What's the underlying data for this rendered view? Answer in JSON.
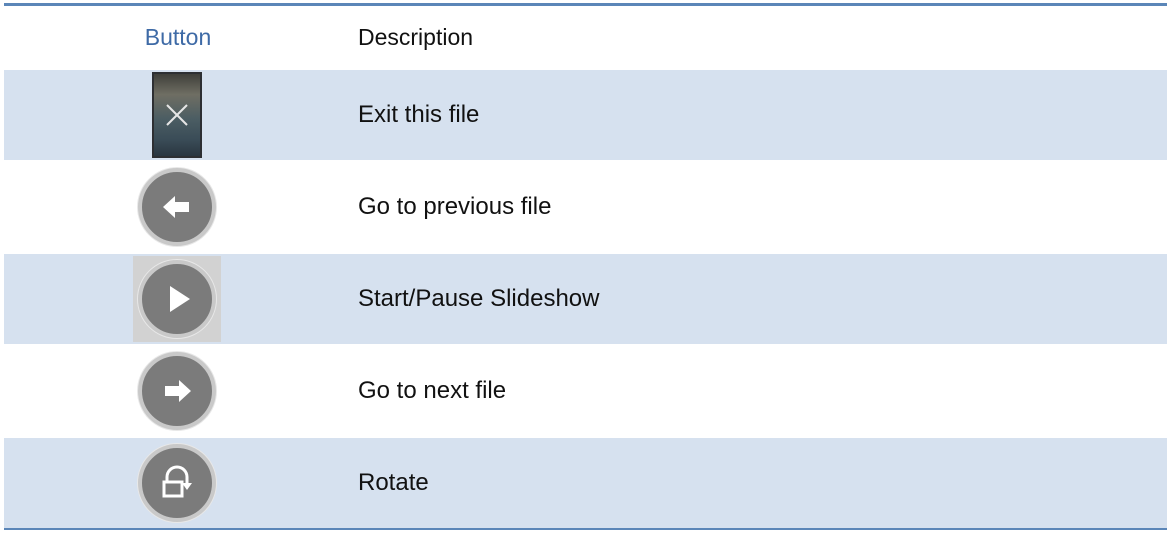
{
  "table": {
    "header": {
      "button_col": "Button",
      "description_col": "Description"
    },
    "rows": [
      {
        "icon": "close-icon",
        "description": "Exit this file"
      },
      {
        "icon": "arrow-left-icon",
        "description": "Go to previous file"
      },
      {
        "icon": "play-icon",
        "description": "Start/Pause Slideshow"
      },
      {
        "icon": "arrow-right-icon",
        "description": "Go to next file"
      },
      {
        "icon": "rotate-icon",
        "description": "Rotate"
      }
    ]
  },
  "colors": {
    "row_band": "#d6e1ef",
    "rule": "#5b86b8",
    "header_accent": "#3e6aa6",
    "icon_fill": "#7b7b7b"
  }
}
